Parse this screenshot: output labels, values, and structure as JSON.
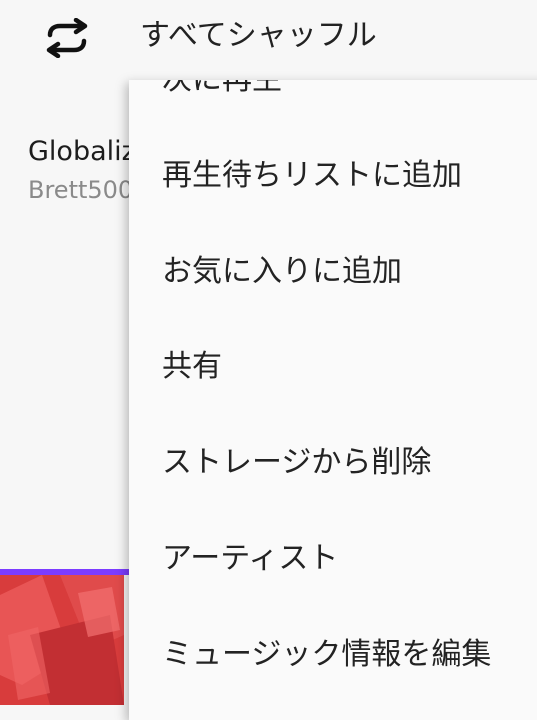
{
  "header": {
    "shuffle_icon": "shuffle-icon",
    "shuffle_label": "すべてシャッフル"
  },
  "track": {
    "title": "Globaliz",
    "artist": "Brett500"
  },
  "colors": {
    "accent": "#7c3cff",
    "album_art": "#d63a3a",
    "background": "#f7f7f7",
    "menu_background": "#fafafa"
  },
  "menu": {
    "items": [
      {
        "label": "次に再生"
      },
      {
        "label": "再生待ちリストに追加"
      },
      {
        "label": "お気に入りに追加"
      },
      {
        "label": "共有"
      },
      {
        "label": "ストレージから削除"
      },
      {
        "label": "アーティスト"
      },
      {
        "label": "ミュージック情報を編集"
      }
    ]
  }
}
